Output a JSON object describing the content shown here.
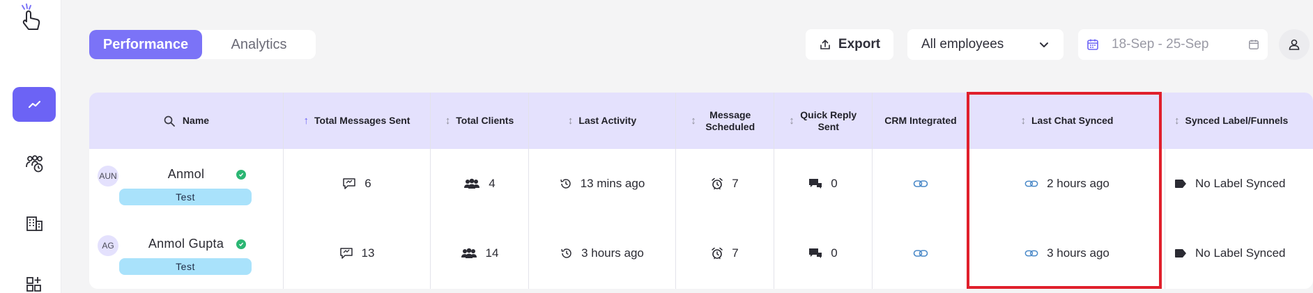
{
  "tabs": [
    {
      "label": "Performance",
      "active": true
    },
    {
      "label": "Analytics",
      "active": false
    }
  ],
  "toolbar": {
    "export_label": "Export",
    "employee_filter": "All employees",
    "date_range": "18-Sep - 25-Sep"
  },
  "table": {
    "columns": [
      {
        "label": "Name"
      },
      {
        "label": "Total Messages Sent"
      },
      {
        "label": "Total Clients"
      },
      {
        "label": "Last Activity"
      },
      {
        "label": "Message Scheduled"
      },
      {
        "label": "Quick Reply Sent"
      },
      {
        "label": "CRM Integrated"
      },
      {
        "label": "Last Chat Synced"
      },
      {
        "label": "Synced Label/Funnels"
      }
    ],
    "rows": [
      {
        "avatar": "AUN",
        "name": "Anmol",
        "tag": "Test",
        "messages": "6",
        "clients": "4",
        "last_activity": "13 mins ago",
        "scheduled": "7",
        "quick_reply": "0",
        "last_chat_synced": "2 hours ago",
        "label": "No Label Synced"
      },
      {
        "avatar": "AG",
        "name": "Anmol Gupta",
        "tag": "Test",
        "messages": "13",
        "clients": "14",
        "last_activity": "3 hours ago",
        "scheduled": "7",
        "quick_reply": "0",
        "last_chat_synced": "3 hours ago",
        "label": "No Label Synced"
      }
    ]
  },
  "colors": {
    "accent": "#6c63f5",
    "header_bg": "#e4e1fd",
    "tag_bg": "#a9e2fb",
    "verified": "#2bb673",
    "highlight": "#e0202c"
  },
  "icons": [
    "hand-click-logo-icon",
    "trend-chart-icon",
    "team-clock-icon",
    "building-icon",
    "add-widget-icon",
    "export-icon",
    "chevron-down-icon",
    "calendar-icon",
    "user-icon",
    "search-icon",
    "sort-icon",
    "chat-icon",
    "users-icon",
    "history-icon",
    "alarm-icon",
    "quick-reply-icon",
    "link-icon",
    "label-icon",
    "verified-check-icon"
  ]
}
